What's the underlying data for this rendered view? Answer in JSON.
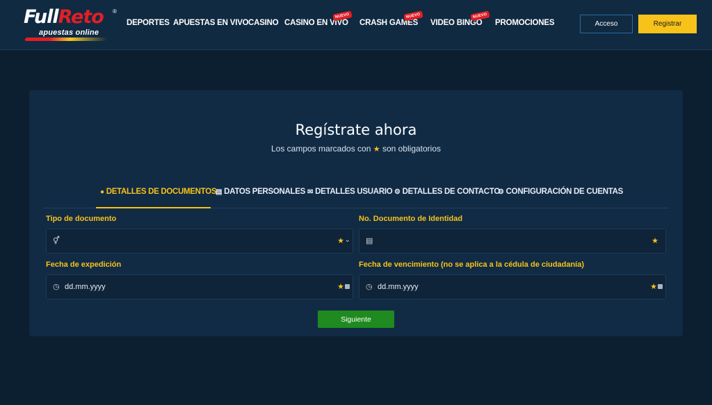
{
  "brand": {
    "logo_main_white": "Full",
    "logo_main_red": "Reto",
    "logo_registered": "®",
    "logo_tagline": "apuestas online",
    "colors": {
      "background": "#0c1f30",
      "header": "#102a42",
      "card": "#112b45",
      "accent": "#f7c21a",
      "brand_red": "#e11f26",
      "next_button": "#1f8a1f"
    }
  },
  "nav": {
    "items": [
      {
        "label": "DEPORTES"
      },
      {
        "label": "APUESTAS EN VIVO"
      },
      {
        "label": "CASINO"
      },
      {
        "label": "CASINO EN VIVO",
        "badge": "NUEVO"
      },
      {
        "label": "CRASH GAMES",
        "badge": "NUEVO"
      },
      {
        "label": "VIDEO BINGO",
        "badge": "NUEVO"
      },
      {
        "label": "PROMOCIONES"
      }
    ]
  },
  "auth": {
    "login_label": "Acceso",
    "register_label": "Registrar"
  },
  "form": {
    "title": "Regístrate ahora",
    "subtitle_before": "Los campos marcados con",
    "subtitle_after": "son obligatorios",
    "tabs": [
      {
        "label": "DETALLES DE DOCUMENTOS",
        "icon": "user-icon",
        "active": true
      },
      {
        "label": "DATOS PERSONALES",
        "icon": "id-card-icon"
      },
      {
        "label": "DETALLES USUARIO",
        "icon": "envelope-icon"
      },
      {
        "label": "DETALLES DE CONTACTO",
        "icon": "gear-icon"
      },
      {
        "label": "CONFIGURACIÓN DE CUENTAS",
        "icon": "gear-icon"
      }
    ],
    "fields": {
      "doc_type": {
        "label": "Tipo de documento",
        "value": "",
        "icon": "gender-icon"
      },
      "doc_number": {
        "label": "No. Documento de Identidad",
        "value": "",
        "icon": "id-card-icon"
      },
      "issue_date": {
        "label": "Fecha de expedición",
        "placeholder": "dd.mm.yyyy",
        "icon": "clock-icon"
      },
      "expiry_date": {
        "label": "Fecha de vencimiento (no se aplica a la cédula de ciudadanía)",
        "placeholder": "dd.mm.yyyy",
        "icon": "clock-icon"
      }
    },
    "next_label": "Siguiente"
  }
}
